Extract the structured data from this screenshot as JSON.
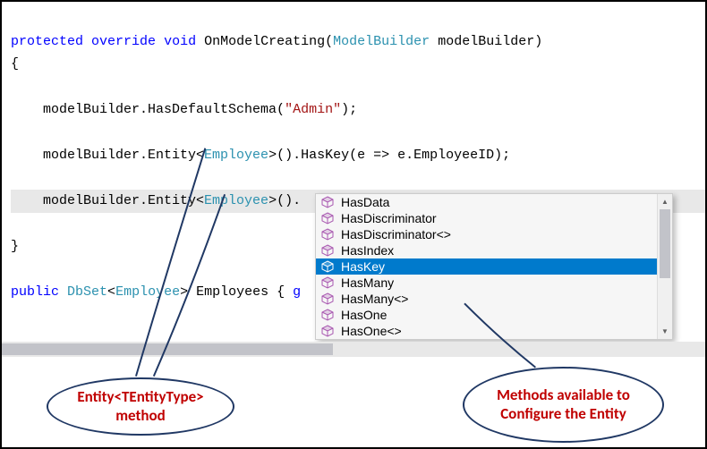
{
  "code": {
    "sig_protected": "protected",
    "sig_override": "override",
    "sig_void": "void",
    "sig_method": "OnModelCreating",
    "sig_paramtype": "ModelBuilder",
    "sig_paramname": "modelBuilder",
    "brace_open": "{",
    "line1_a": "    modelBuilder.HasDefaultSchema(",
    "line1_str": "\"Admin\"",
    "line1_b": ");",
    "line2_a": "    modelBuilder.Entity<",
    "line2_type": "Employee",
    "line2_b": ">().HasKey(e => e.EmployeeID);",
    "line3_a": "    modelBuilder.Entity<",
    "line3_type": "Employee",
    "line3_b": ">().",
    "brace_close": "}",
    "prop_public": "public",
    "prop_dbset": "DbSet",
    "prop_emp": "Employee",
    "prop_name": "Employees",
    "prop_get": "g"
  },
  "intellisense": {
    "items": [
      {
        "label": "HasData",
        "selected": false
      },
      {
        "label": "HasDiscriminator",
        "selected": false
      },
      {
        "label": "HasDiscriminator<>",
        "selected": false
      },
      {
        "label": "HasIndex",
        "selected": false
      },
      {
        "label": "HasKey",
        "selected": true
      },
      {
        "label": "HasMany",
        "selected": false
      },
      {
        "label": "HasMany<>",
        "selected": false
      },
      {
        "label": "HasOne",
        "selected": false
      },
      {
        "label": "HasOne<>",
        "selected": false
      }
    ]
  },
  "annotations": {
    "left": "Entity<TEntityType> method",
    "right": "Methods available to Configure the Entity"
  }
}
